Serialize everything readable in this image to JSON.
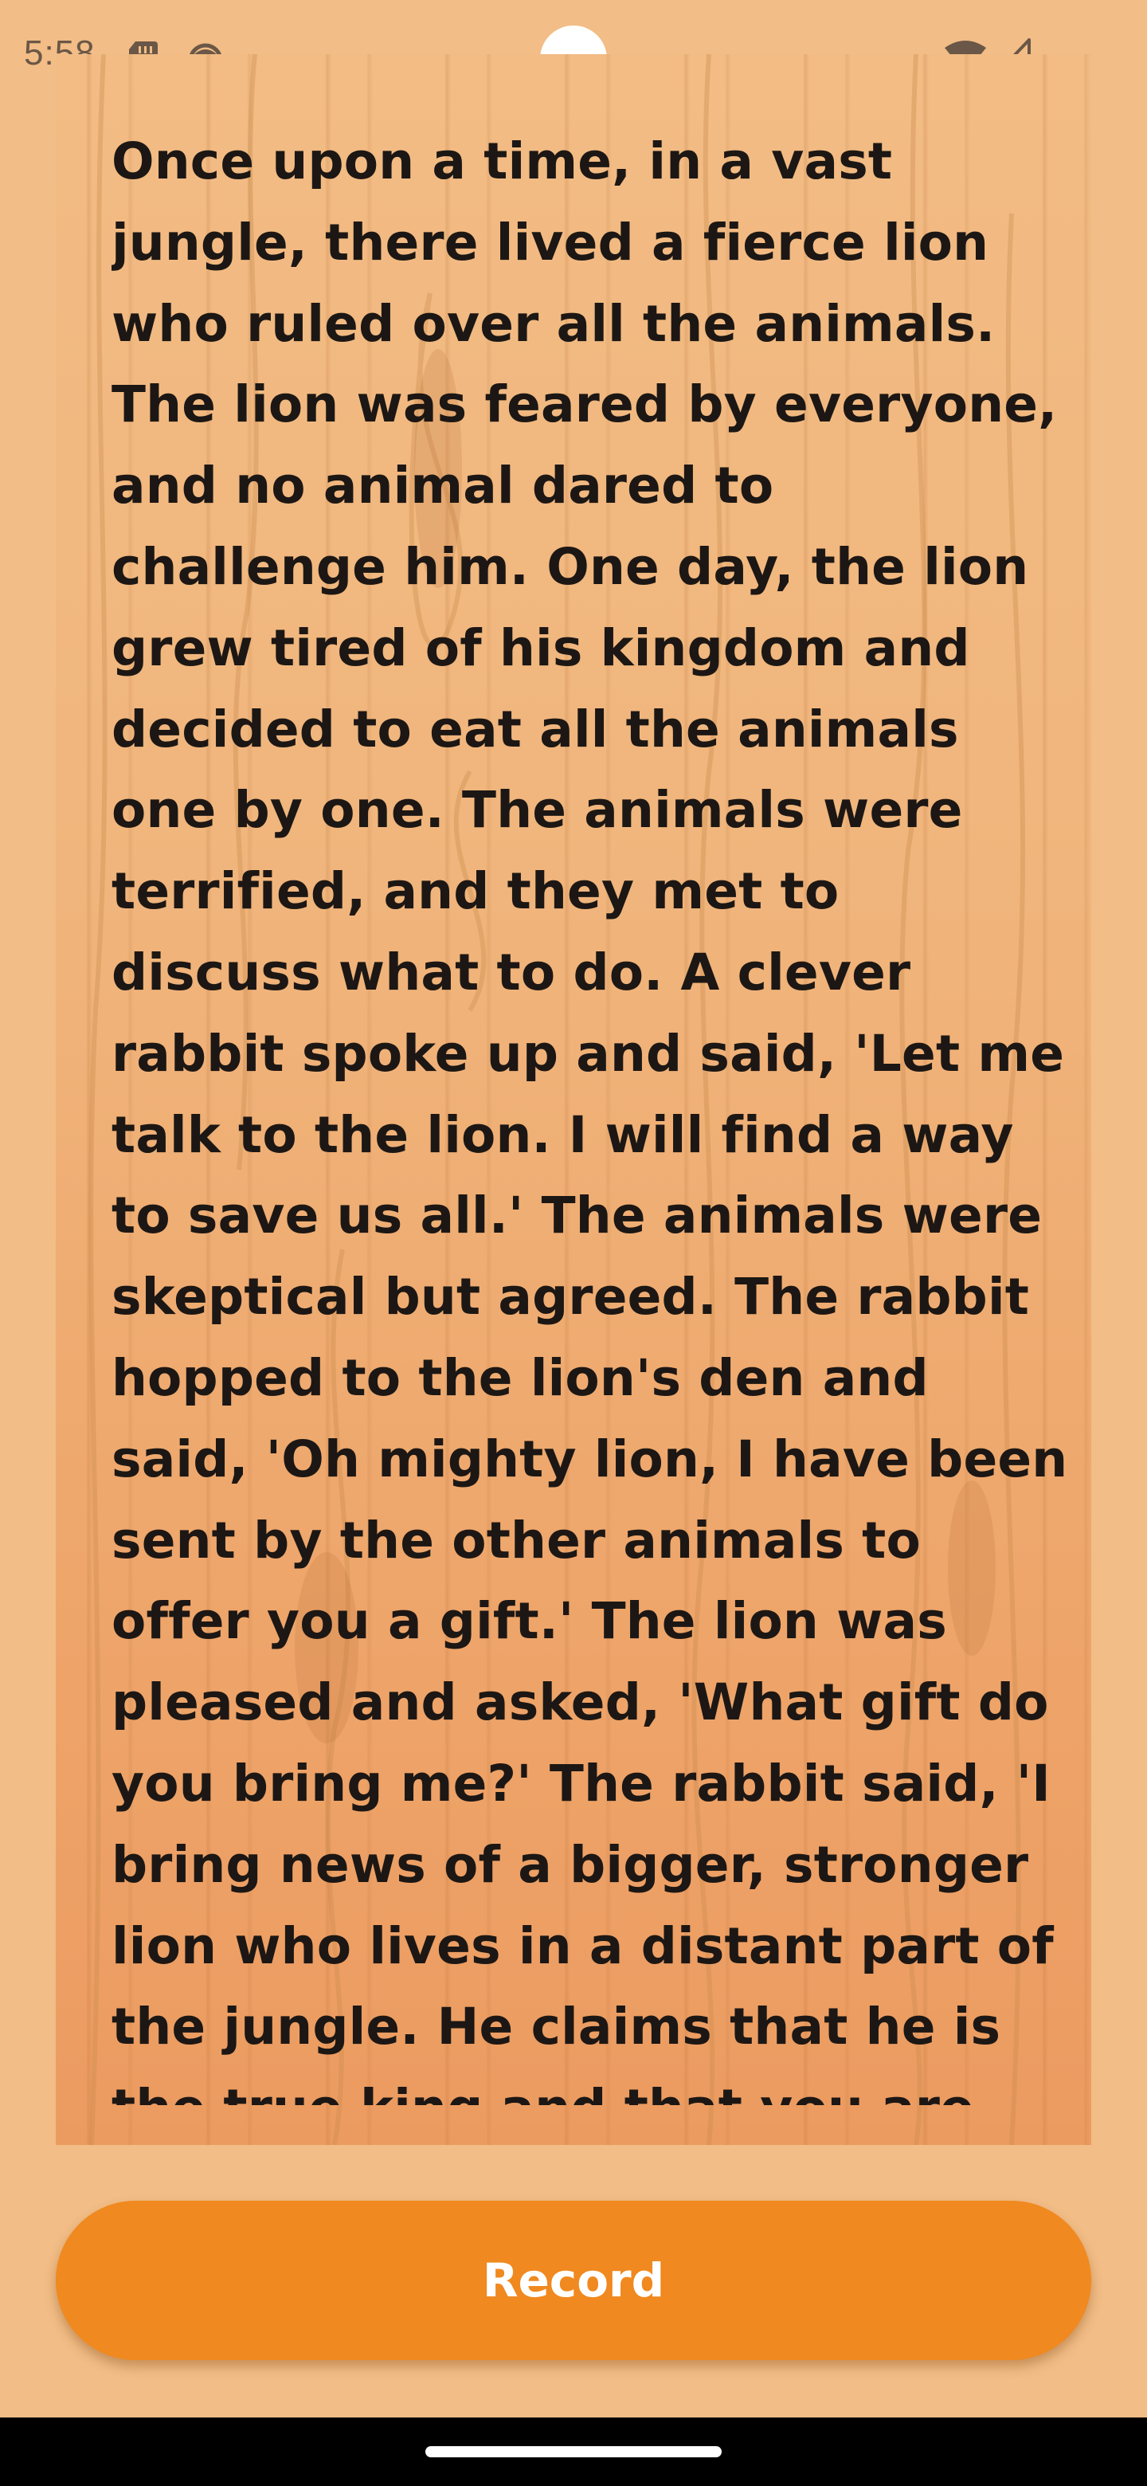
{
  "status_bar": {
    "time": "5:58",
    "icons": [
      "sd-card-icon",
      "face-icon",
      "wifi-icon",
      "signal-icon"
    ]
  },
  "story": {
    "text": "Once upon a time, in a vast\njungle, there lived a fierce lion\nwho ruled over all the animals.\nThe lion was feared by everyone,\nand no animal dared to\nchallenge him. One day, the lion\ngrew tired of his kingdom and\ndecided to eat all the animals\none by one. The animals were\nterrified, and they met to\ndiscuss what to do. A clever\nrabbit spoke up and said, 'Let me\ntalk to the lion. I will find a way\nto save us all.' The animals were\nskeptical but agreed. The rabbit\nhopped to the lion's den and\nsaid, 'Oh mighty lion, I have been\nsent by the other animals to\noffer you a gift.' The lion was\npleased and asked, 'What gift do\nyou bring me?' The rabbit said, 'I\nbring news of a bigger, stronger\nlion who lives in a distant part of\nthe jungle. He claims that he is\nthe true king and that you are"
  },
  "record_button": {
    "label": "Record"
  },
  "colors": {
    "background": "#f2bd86",
    "button": "#f0891f",
    "text": "#1c1714",
    "nav_bar": "#000000"
  }
}
